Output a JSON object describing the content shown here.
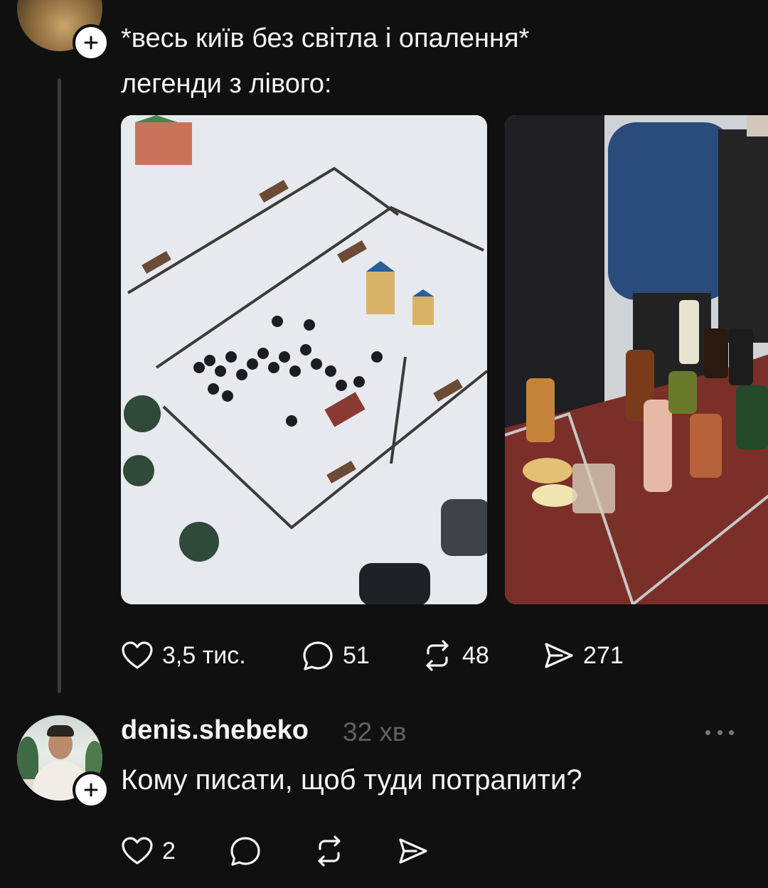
{
  "post": {
    "text_line_1": "*весь київ без світла і опалення*",
    "text_line_2": "легенди з лівого:",
    "images": [
      {
        "icon": "photo-snowy-playground-gathering"
      },
      {
        "icon": "photo-table-with-bottles"
      }
    ],
    "actions": {
      "likes": "3,5 тис.",
      "comments": "51",
      "reposts": "48",
      "shares": "271"
    }
  },
  "reply": {
    "username": "denis.shebeko",
    "time": "32 хв",
    "text": "Кому писати, щоб туди потрапити?",
    "actions": {
      "likes": "2"
    }
  },
  "colors": {
    "background": "#101010",
    "text": "#f3f5f7",
    "muted": "#616161",
    "thread_line": "#3a3a3a"
  }
}
